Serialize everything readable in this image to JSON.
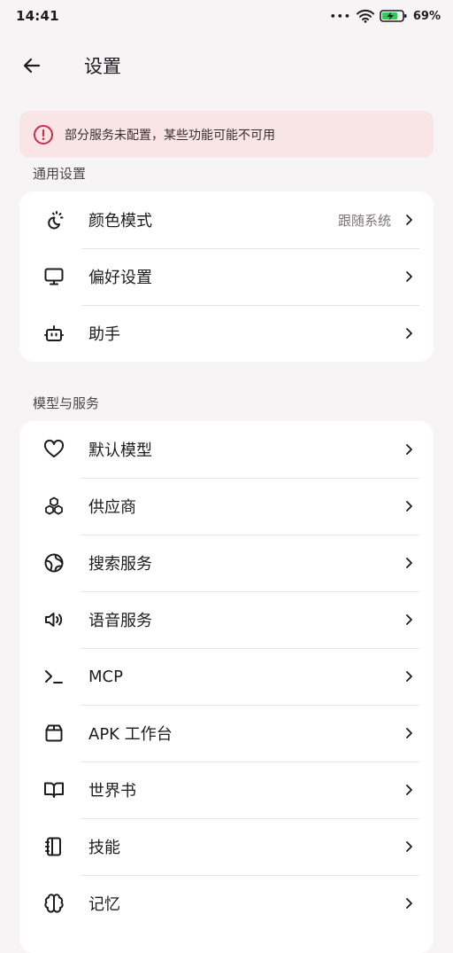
{
  "status_bar": {
    "time": "14:41",
    "more": "•••",
    "battery_percent": "69%"
  },
  "header": {
    "title": "设置"
  },
  "warning": {
    "text": "部分服务未配置，某些功能可能不可用",
    "accent": "#d12a4a"
  },
  "general": {
    "label": "通用设置",
    "items": [
      {
        "label": "颜色模式",
        "value": "跟随系统",
        "icon": "theme-icon"
      },
      {
        "label": "偏好设置",
        "icon": "monitor-icon"
      },
      {
        "label": "助手",
        "icon": "bot-icon"
      }
    ]
  },
  "models": {
    "label": "模型与服务",
    "items": [
      {
        "label": "默认模型",
        "icon": "heart-icon"
      },
      {
        "label": "供应商",
        "icon": "boxes-icon"
      },
      {
        "label": "搜索服务",
        "icon": "globe-icon"
      },
      {
        "label": "语音服务",
        "icon": "speaker-icon"
      },
      {
        "label": "MCP",
        "icon": "terminal-icon"
      },
      {
        "label": "APK 工作台",
        "icon": "package-icon"
      },
      {
        "label": "世界书",
        "icon": "book-icon"
      },
      {
        "label": "技能",
        "icon": "notebook-icon"
      },
      {
        "label": "记忆",
        "icon": "brain-icon"
      }
    ]
  }
}
